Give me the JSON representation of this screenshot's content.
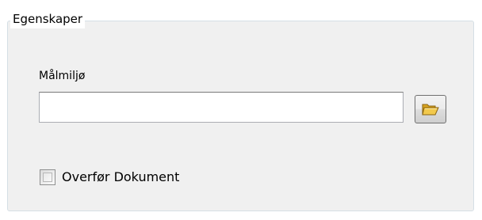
{
  "group": {
    "title": "Egenskaper",
    "field_label": "Målmiljø",
    "field_value": "",
    "browse_icon": "folder-open-icon",
    "checkbox_label": "Overfør Dokument",
    "checkbox_checked": false
  },
  "colors": {
    "panel_bg": "#f0f0f0",
    "group_border": "#d5dfe5",
    "input_border": "#abadb3",
    "folder_fill": "#f2c94c"
  }
}
